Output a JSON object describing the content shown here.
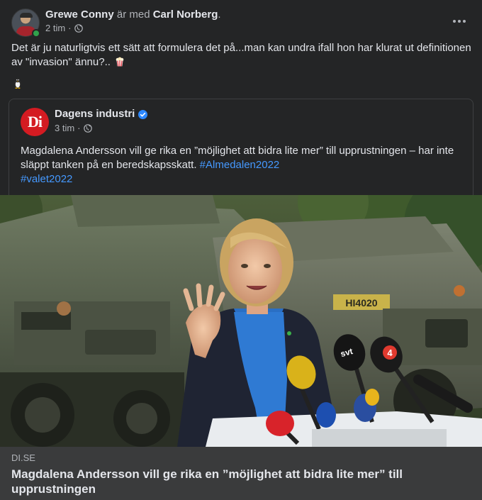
{
  "post": {
    "author": "Grewe Conny",
    "with_text": "är med",
    "tagged": "Carl Norberg",
    "tagged_suffix": ".",
    "time": "2 tim",
    "text": "Det är ju naturligtvis ett sätt att formulera det på...man kan undra ifall hon har klurat ut definitionen av \"invasion\" ännu?..",
    "icons": [
      "popcorn-icon",
      "penguin-icon",
      "globe-icon",
      "more-icon"
    ]
  },
  "shared": {
    "page_name": "Dagens industri",
    "logo_text": "Di",
    "time": "3 tim",
    "text": "Magdalena Andersson vill ge rika en ”möjlighet att bidra lite mer” till upprustningen – har inte släppt tanken på en beredskapsskatt.",
    "hashtags": [
      "#Almedalen2022",
      "#valet2022"
    ],
    "icons": [
      "verified-icon",
      "globe-icon"
    ]
  },
  "photo": {
    "vehicle_plate": "HI4020",
    "mic_labels": [
      "svt",
      "4"
    ]
  },
  "link": {
    "domain": "DI.SE",
    "title": "Magdalena Andersson vill ge rika en ”möjlighet att bidra lite mer” till upprustningen"
  },
  "colors": {
    "background": "#242526",
    "text": "#e4e6eb",
    "secondary_text": "#b0b3b8",
    "link": "#4599ff",
    "online": "#31a24c",
    "di_brand": "#d41b22",
    "footer": "#3a3b3c"
  }
}
